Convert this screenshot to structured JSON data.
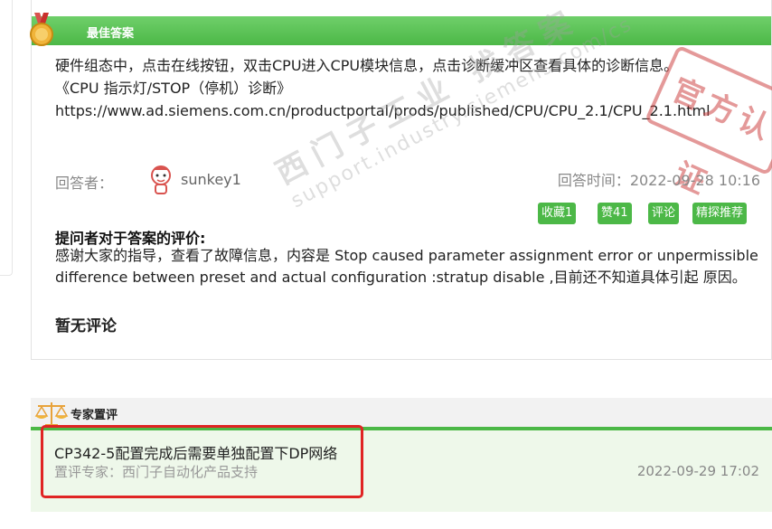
{
  "best_answer": {
    "header_label": "最佳答案",
    "lines": [
      "硬件组态中，点击在线按钮，双击CPU进入CPU模块信息，点击诊断缓冲区查看具体的诊断信息。",
      "《CPU 指示灯/STOP（停机）诊断》",
      "https://www.ad.siemens.com.cn/productportal/prods/published/CPU/CPU_2.1/CPU_2.1.html"
    ],
    "stamp_text": "官方认证",
    "answerer_label": "回答者：",
    "username": "sunkey1",
    "answer_time": "回答时间：2022-09-28 10:16",
    "actions": [
      "收藏1",
      "赞41",
      "评论",
      "精探推荐"
    ],
    "eval_title": "提问者对于答案的评价:",
    "eval_text": "感谢大家的指导，查看了故障信息，内容是 Stop caused parameter assignment error or unpermissible difference between preset and actual configuration :stratup disable ,目前还不知道具体引起 原因。",
    "no_comment": "暂无评论",
    "watermark_main": "西门子工业 找答案",
    "watermark_url": "support.industry.siemens.com/cs"
  },
  "expert_review": {
    "header_label": "专家置评",
    "question": "CP342-5配置完成后需要单独配置下DP网络",
    "reviewer": "置评专家：西门子自动化产品支持",
    "time": "2022-09-29 17:02"
  },
  "colors": {
    "accent_green": "#4cb847",
    "highlight_red": "#e02424"
  }
}
